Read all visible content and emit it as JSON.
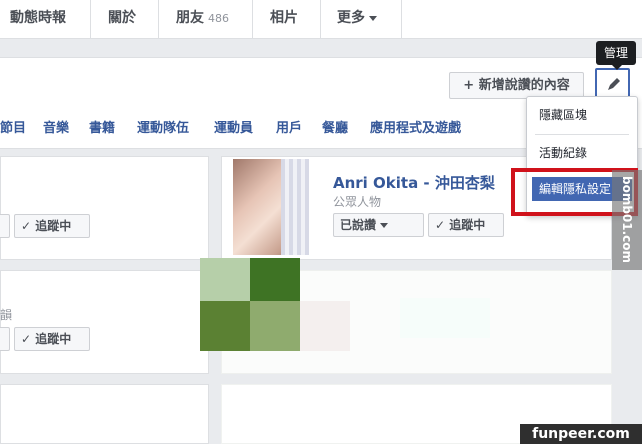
{
  "nav": {
    "tabs": [
      {
        "label": "動態時報"
      },
      {
        "label": "關於"
      },
      {
        "label": "朋友",
        "count": "486"
      },
      {
        "label": "相片"
      },
      {
        "label": "更多"
      }
    ]
  },
  "toolbar": {
    "add_liked_label": "+ 新增說讚的內容",
    "tooltip": "管理"
  },
  "categories": [
    "節目",
    "音樂",
    "書籍",
    "運動隊伍",
    "運動員",
    "用戶",
    "餐廳",
    "應用程式及遊戲"
  ],
  "menu": {
    "items": [
      "隱藏區塊",
      "活動紀錄",
      "編輯隱私設定"
    ]
  },
  "cards": {
    "anri": {
      "name": "Anri Okita - 沖田杏梨",
      "category": "公眾人物",
      "liked_label": "已說讚",
      "following_label": "✓ 追蹤中"
    },
    "left1": {
      "following_label": "✓ 追蹤中"
    },
    "left2": {
      "fragment": "韻",
      "following_label": "✓ 追蹤中"
    }
  },
  "watermarks": {
    "side": "bomb01.com",
    "footer": "funpeer.com"
  },
  "colors": {
    "highlight": "#d0121b",
    "link": "#365899",
    "selected": "#4267b2"
  }
}
